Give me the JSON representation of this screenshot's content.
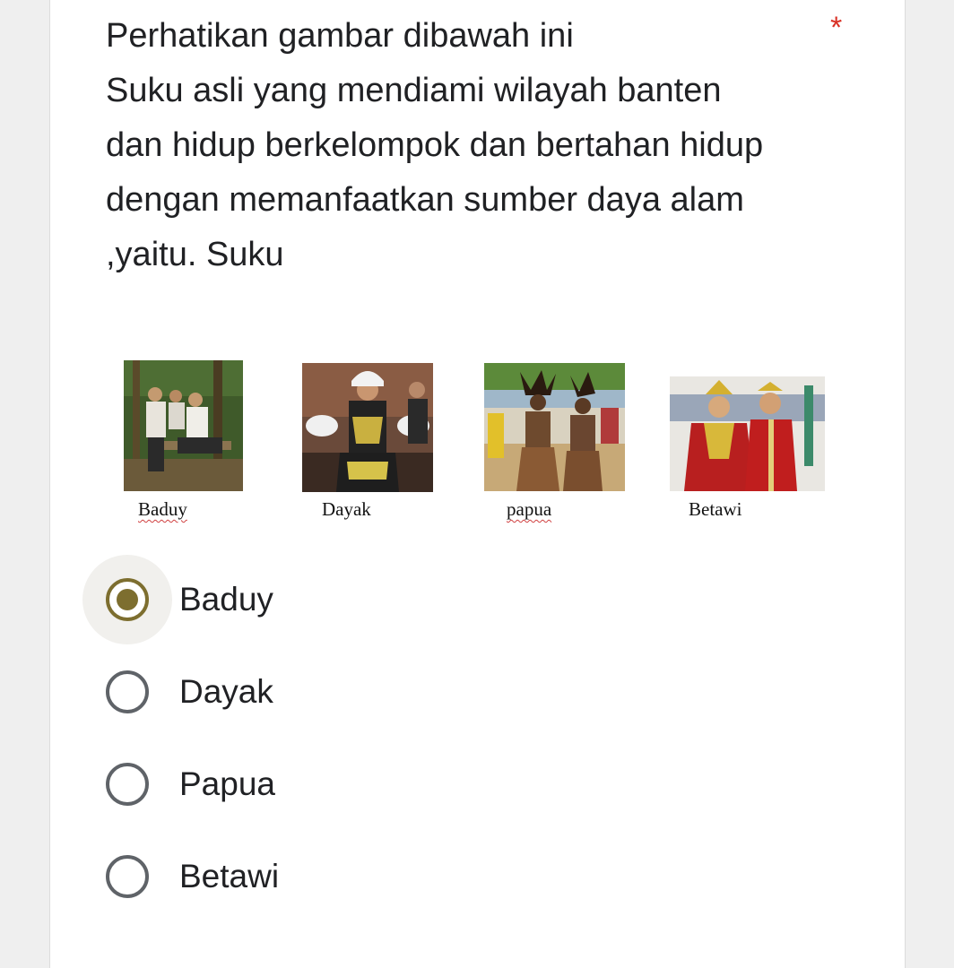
{
  "question": {
    "lines": [
      "Perhatikan gambar dibawah ini",
      "Suku asli yang mendiami wilayah banten",
      "dan hidup berkelompok dan bertahan hidup",
      "dengan memanfaatkan sumber daya alam",
      ",yaitu. Suku"
    ],
    "required_marker": "*"
  },
  "figure": {
    "captions": [
      "Baduy",
      "Dayak",
      "papua",
      "Betawi"
    ]
  },
  "options": [
    {
      "label": "Baduy",
      "selected": true
    },
    {
      "label": "Dayak",
      "selected": false
    },
    {
      "label": "Papua",
      "selected": false
    },
    {
      "label": "Betawi",
      "selected": false
    }
  ],
  "colors": {
    "accent": "#7d6e2f",
    "required": "#d93025",
    "text": "#202124",
    "radio_border": "#5f6368"
  },
  "icons": {
    "radio_selected": "radio-checked-icon",
    "radio_unselected": "radio-unchecked-icon"
  }
}
